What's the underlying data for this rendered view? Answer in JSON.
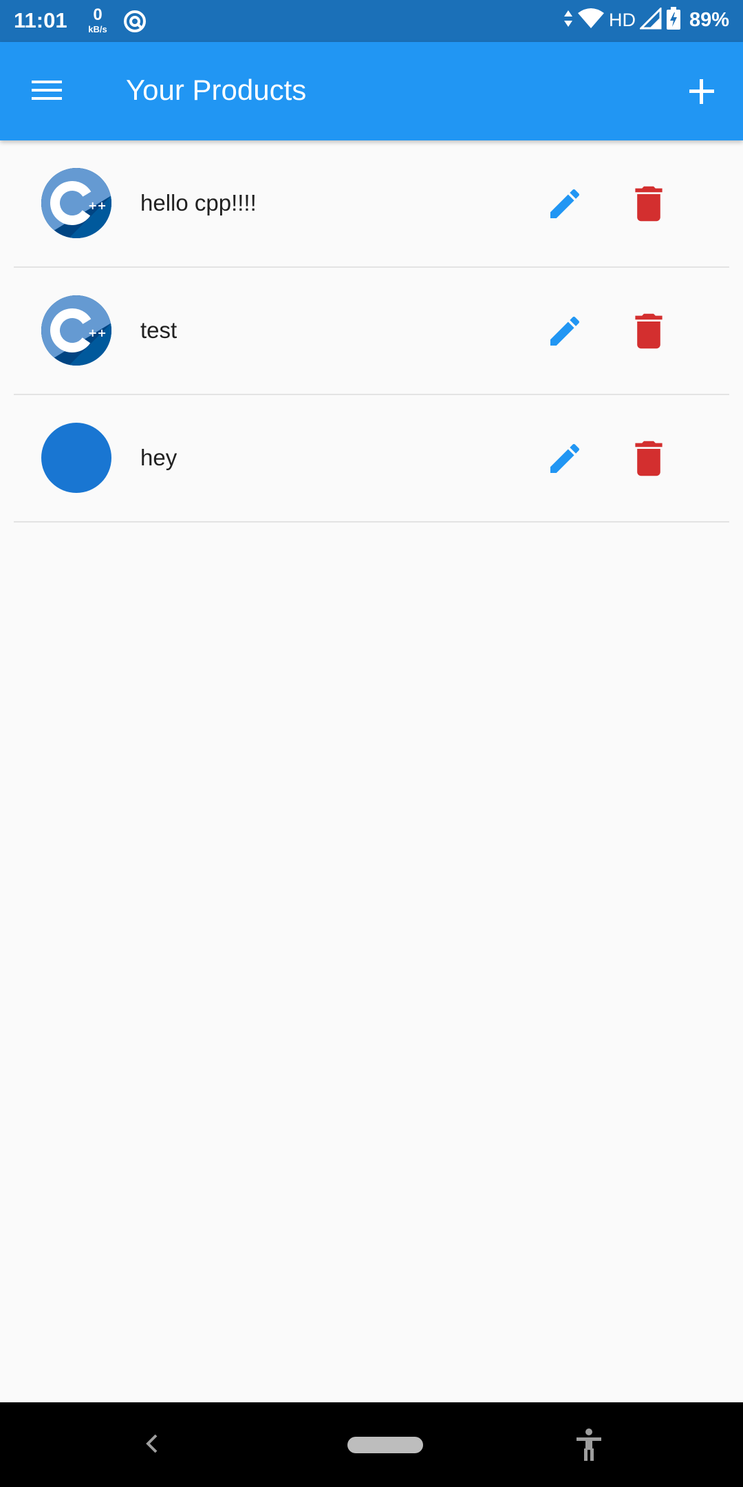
{
  "status_bar": {
    "time": "11:01",
    "net_speed_value": "0",
    "net_speed_unit": "kB/s",
    "network_type": "HD",
    "battery": "89%",
    "icons": [
      "data-saver-icon",
      "data-arrows-icon",
      "wifi-icon",
      "signal-icon",
      "battery-charging-icon"
    ]
  },
  "app_bar": {
    "title": "Your Products",
    "menu_icon": "menu-icon",
    "add_icon": "add-icon",
    "color": "#2196f3"
  },
  "products": [
    {
      "title": "hello cpp!!!!",
      "image": "cpp-logo"
    },
    {
      "title": "test",
      "image": "cpp-logo"
    },
    {
      "title": "hey",
      "image": "blue-circle"
    }
  ],
  "actions": {
    "edit_icon": "pencil-icon",
    "edit_color": "#2196f3",
    "delete_icon": "trash-icon",
    "delete_color": "#d32f2f"
  },
  "nav_bar": {
    "icons": [
      "back-icon",
      "home-pill-icon",
      "accessibility-icon"
    ]
  }
}
